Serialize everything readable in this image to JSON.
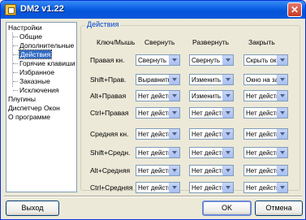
{
  "window": {
    "title": "DM2 v1.22"
  },
  "tree": {
    "items": [
      {
        "label": "Настройки"
      },
      {
        "label": "Общие"
      },
      {
        "label": "Дополнительные"
      },
      {
        "label": "Действия"
      },
      {
        "label": "Горячие клавиши"
      },
      {
        "label": "Избранное"
      },
      {
        "label": "Заказные"
      },
      {
        "label": "Исключения"
      },
      {
        "label": "Плугины"
      },
      {
        "label": "Диспетчер Окон"
      },
      {
        "label": "О программе"
      }
    ]
  },
  "actions": {
    "group_title": "Действия",
    "headers": {
      "key": "Ключ/Мышь",
      "minimize": "Свернуть",
      "maximize": "Развернуть",
      "close": "Закрыть"
    },
    "rows": [
      {
        "label": "Правая кн.",
        "minimize": "Свернуть",
        "maximize": "Свернуть",
        "close": "Скрыть окно"
      },
      {
        "label": "Shift+Прав.",
        "minimize": "Выравнить",
        "maximize": "Изменить",
        "close": "Окно на задний план"
      },
      {
        "label": "Alt+Правая",
        "minimize": "Нет действия",
        "maximize": "Изменить",
        "close": "Нет действия"
      },
      {
        "label": "Ctrl+Правая",
        "minimize": "Нет действия",
        "maximize": "Нет действия",
        "close": "Нет действия"
      },
      {
        "label": "Средняя кн.",
        "minimize": "Нет действия",
        "maximize": "Нет действия",
        "close": "Нет действия"
      },
      {
        "label": "Shift+Средн.",
        "minimize": "Нет действия",
        "maximize": "Нет действия",
        "close": "Нет действия"
      },
      {
        "label": "Alt+Средняя",
        "minimize": "Нет действия",
        "maximize": "Нет действия",
        "close": "Нет действия"
      },
      {
        "label": "Ctrl+Средняя",
        "minimize": "Нет действия",
        "maximize": "Нет действия",
        "close": "Нет действия"
      }
    ]
  },
  "buttons": {
    "exit": "Выход",
    "ok": "OK",
    "cancel": "Отмена"
  }
}
